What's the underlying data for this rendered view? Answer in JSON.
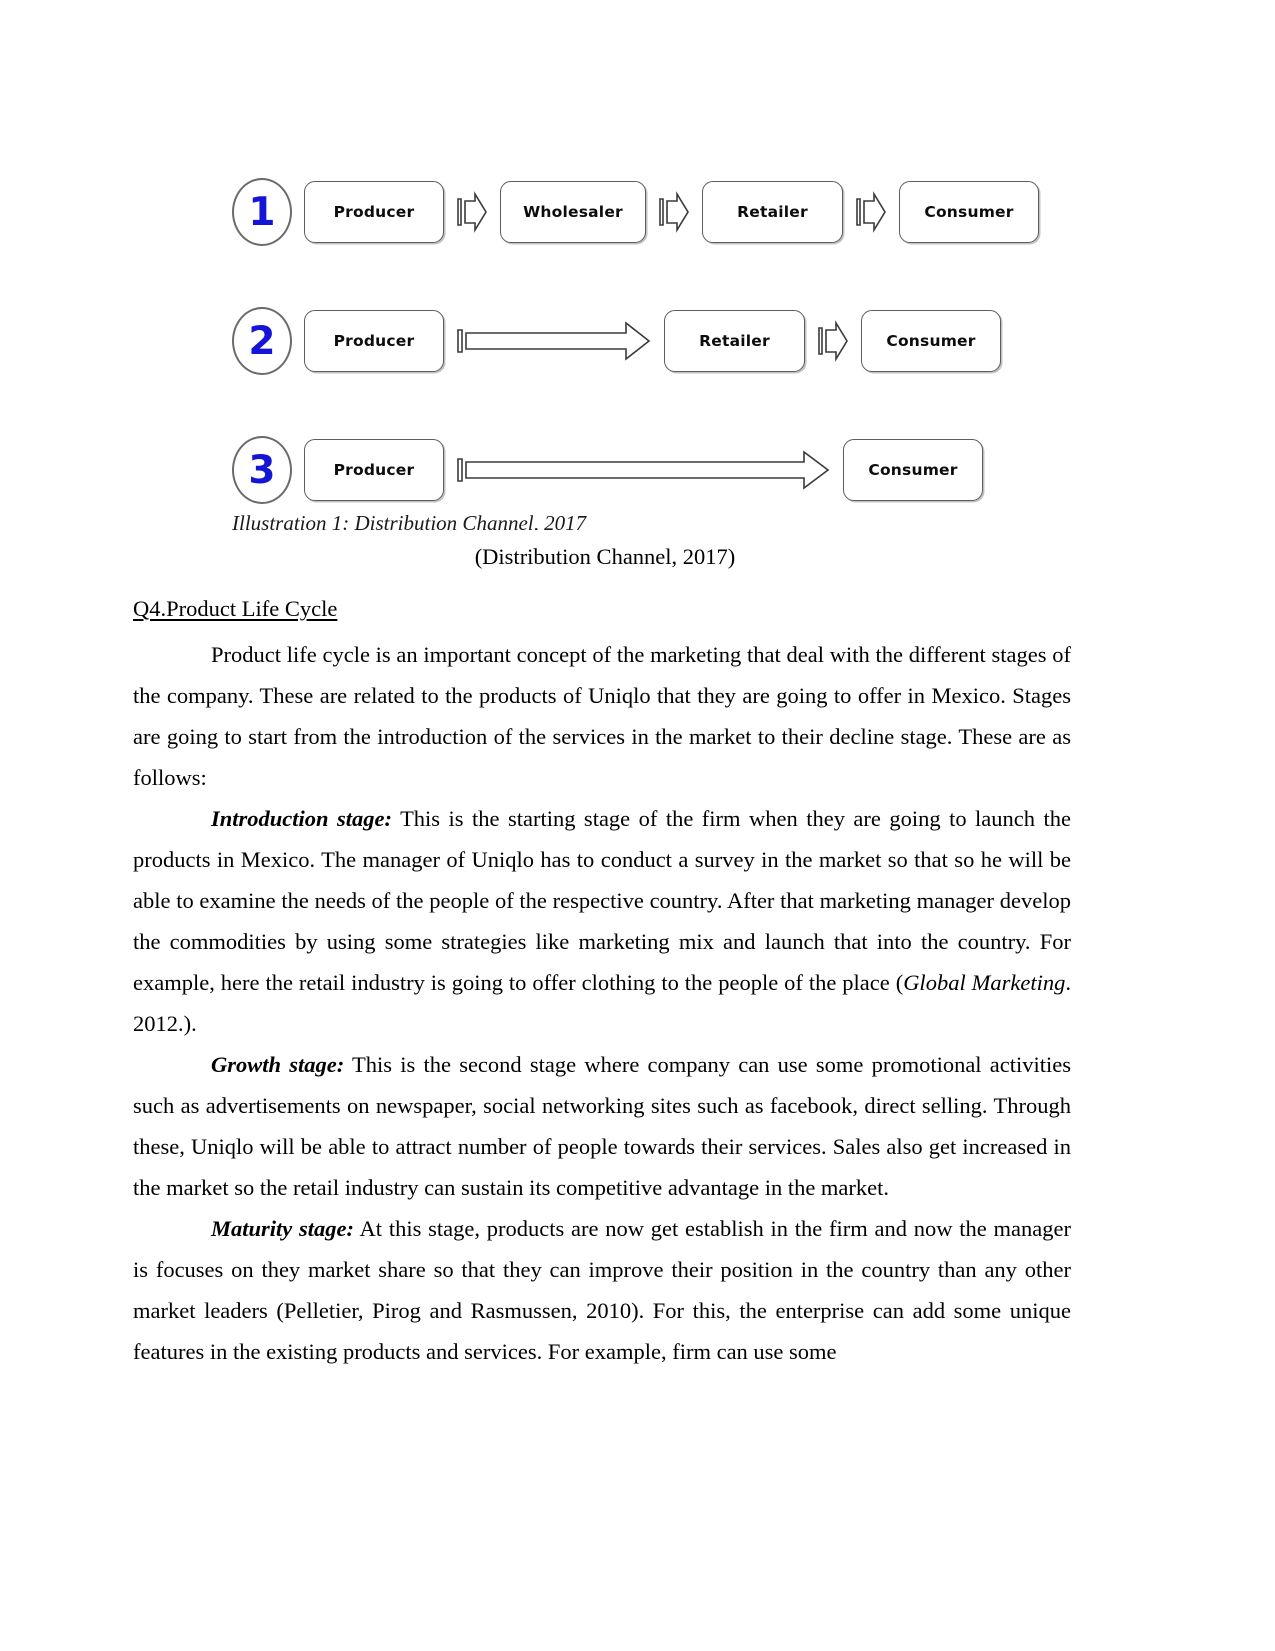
{
  "figure": {
    "caption": "Illustration 1: Distribution Channel, 2017",
    "source_line": "(Distribution Channel, 2017)",
    "number_color": "#1515d8",
    "rows": [
      {
        "number": "1",
        "nodes": [
          "Producer",
          "Wholesaler",
          "Retailer",
          "Consumer"
        ],
        "connectors": [
          "short-arrow",
          "short-arrow",
          "short-arrow"
        ]
      },
      {
        "number": "2",
        "nodes": [
          "Producer",
          "Retailer",
          "Consumer"
        ],
        "connectors": [
          "long-arrow",
          "short-arrow"
        ]
      },
      {
        "number": "3",
        "nodes": [
          "Producer",
          "Consumer"
        ],
        "connectors": [
          "long-arrow"
        ]
      }
    ]
  },
  "content": {
    "heading": "Q4.Product Life Cycle",
    "p1": "Product life cycle is an important concept of the marketing that deal with the different stages of the company. These are related to the products of Uniqlo that they are going to offer in Mexico. Stages are going to start from the introduction of the services in the market to their decline stage. These are as follows:",
    "p2_label": "Introduction stage:",
    "p2_a": " This is the starting stage of the firm when they are going to launch the products in Mexico. The manager of Uniqlo has to conduct a survey in the market so that so he will be able to examine the needs of the people of the respective country. After that marketing manager develop the commodities by using some strategies like marketing mix and launch that into the country. For example, here the retail industry is going to offer clothing to the people of the place (",
    "p2_italic": "Global Marketing",
    "p2_b": ". 2012.).",
    "p3_label": "Growth stage:",
    "p3_text": " This is the second stage where company can use some promotional activities such as advertisements on newspaper, social networking sites such as facebook, direct selling. Through these,  Uniqlo will be able to attract number of people towards their services. Sales also get increased in the market so the retail industry can sustain its competitive advantage in the market.",
    "p4_label": "Maturity stage:",
    "p4_text": " At this stage, products are now get establish in the firm and now the manager is focuses on they market share so that they can improve their position in the country than any other market leaders (Pelletier, Pirog and Rasmussen, 2010). For this, the enterprise can add some unique features in the existing products and services. For example, firm can use some"
  }
}
